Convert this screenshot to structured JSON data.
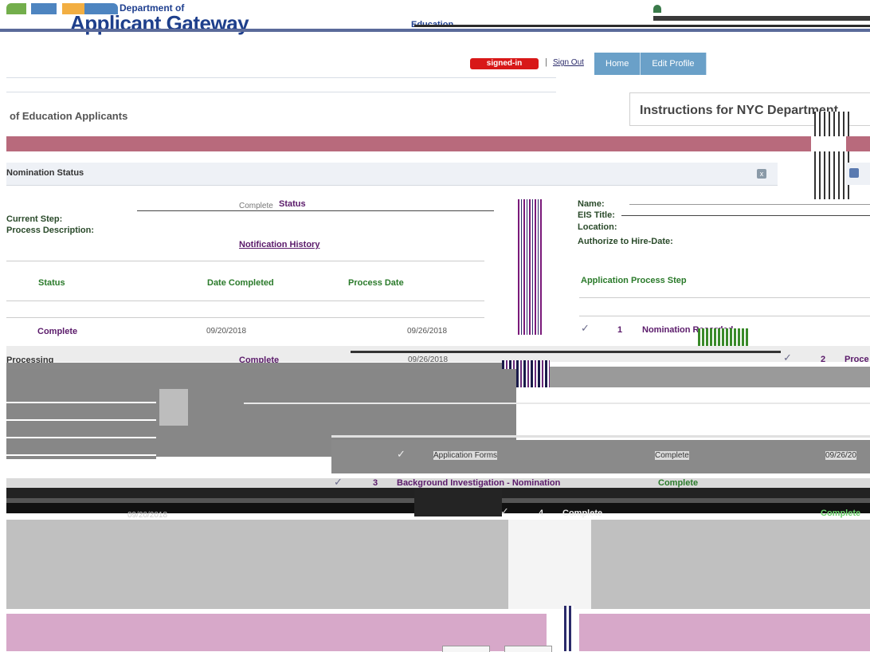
{
  "header": {
    "dept_top": "Department of",
    "title": "Applicant Gateway",
    "dept_bottom": "Education"
  },
  "nav": {
    "user_badge": "signed-in",
    "separator": "|",
    "signout": "Sign Out",
    "tabs": [
      {
        "label": "Home"
      },
      {
        "label": "Edit Profile"
      }
    ]
  },
  "left": {
    "title": "of Education Applicants",
    "title_link": ""
  },
  "right": {
    "title": "Instructions for NYC Department"
  },
  "nomination": {
    "title": "Nomination Status",
    "close_icon": "x",
    "status_heading": "Status",
    "status_small": "Complete",
    "label_current": "Current Step:",
    "label_process": "Process Description:",
    "notif_link": "Notification History",
    "columns": {
      "status": "Status",
      "date": "Date Completed",
      "process": "Process Date"
    },
    "rows": [
      {
        "status": "Complete",
        "date": "09/20/2018",
        "process": "09/26/2018"
      }
    ],
    "right_labels": {
      "name": "Name:",
      "eis": "EIS Title:",
      "location": "Location:",
      "auth": "Authorize to Hire-Date:"
    },
    "app_step_head": "Application Process Step",
    "steps": [
      {
        "num": "1",
        "name": "Nomination Recorded"
      },
      {
        "num": "2",
        "name": "Proce"
      }
    ]
  },
  "glitch": {
    "sleeping": "Processing",
    "complete": "Complete",
    "date": "09/26/2018",
    "app_forms": "Application Forms",
    "app_forms_complete": "Complete",
    "app_forms_date": "09/26/20",
    "bg_num": "3",
    "bg_name": "Background Investigation - Nomination",
    "bg_complete": "Complete",
    "row4_num": "4",
    "row4_label": "Complete",
    "row4_right": "Complete",
    "lower_date": "09/20/2018"
  },
  "colors": {
    "brand_blue": "#1e3f8c",
    "nav_tab": "#6aa0c8",
    "pink_bar": "#b86a7c",
    "purple_text": "#5a1a6a",
    "green_text": "#2a7a2a",
    "badge_red": "#d81818"
  }
}
